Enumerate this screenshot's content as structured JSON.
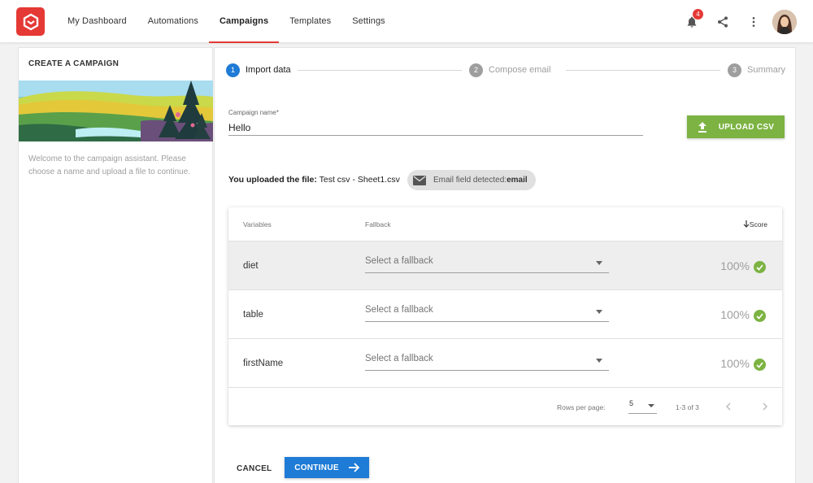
{
  "nav": {
    "items": [
      {
        "label": "My Dashboard",
        "active": false
      },
      {
        "label": "Automations",
        "active": false
      },
      {
        "label": "Campaigns",
        "active": true
      },
      {
        "label": "Templates",
        "active": false
      },
      {
        "label": "Settings",
        "active": false
      }
    ],
    "notification_count": "4",
    "icons": [
      "bell-icon",
      "share-icon",
      "more-vert-icon"
    ]
  },
  "sidebar": {
    "title": "CREATE A CAMPAIGN",
    "description": "Welcome to the campaign assistant. Please choose a name and upload a file to continue."
  },
  "stepper": {
    "steps": [
      {
        "num": "1",
        "label": "Import data",
        "active": true
      },
      {
        "num": "2",
        "label": "Compose email",
        "active": false
      },
      {
        "num": "3",
        "label": "Summary",
        "active": false
      }
    ]
  },
  "form": {
    "campaign_name_label": "Campaign name*",
    "campaign_name_value": "Hello",
    "upload_label": "UPLOAD CSV"
  },
  "upload_info": {
    "prefix": "You uploaded the file:",
    "filename": "Test csv - Sheet1.csv",
    "chip_prefix": "Email field detected:",
    "chip_field": "email"
  },
  "table": {
    "headers": {
      "variables": "Variables",
      "fallback": "Fallback",
      "score": "Score"
    },
    "rows": [
      {
        "variable": "diet",
        "fallback_placeholder": "Select a fallback",
        "score": "100%"
      },
      {
        "variable": "table",
        "fallback_placeholder": "Select a fallback",
        "score": "100%"
      },
      {
        "variable": "firstName",
        "fallback_placeholder": "Select a fallback",
        "score": "100%"
      }
    ],
    "footer": {
      "rows_per_page_label": "Rows per page:",
      "rows_per_page_value": "5",
      "range": "1-3 of 3"
    }
  },
  "actions": {
    "cancel_label": "CANCEL",
    "continue_label": "CONTINUE"
  },
  "colors": {
    "brand": "#e53935",
    "primary": "#1e7bd6",
    "success": "#7cb342"
  }
}
